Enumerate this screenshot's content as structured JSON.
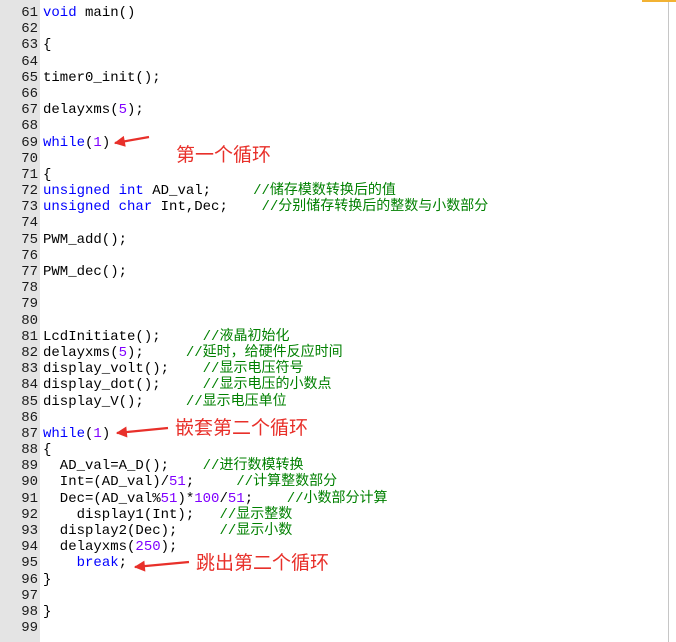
{
  "editor": {
    "lines": [
      {
        "n": "61",
        "tokens": [
          {
            "keyword": "void"
          },
          {
            "text": " main()"
          }
        ]
      },
      {
        "n": "62",
        "tokens": []
      },
      {
        "n": "63",
        "tokens": [
          {
            "text": "{"
          }
        ]
      },
      {
        "n": "64",
        "tokens": []
      },
      {
        "n": "65",
        "tokens": [
          {
            "text": "timer0_init();"
          }
        ]
      },
      {
        "n": "66",
        "tokens": []
      },
      {
        "n": "67",
        "tokens": [
          {
            "text": "delayxms("
          },
          {
            "number": "5"
          },
          {
            "text": ");"
          }
        ]
      },
      {
        "n": "68",
        "tokens": []
      },
      {
        "n": "69",
        "tokens": [
          {
            "keyword": "while"
          },
          {
            "text": "("
          },
          {
            "number": "1"
          },
          {
            "text": ")"
          }
        ]
      },
      {
        "n": "70",
        "tokens": []
      },
      {
        "n": "71",
        "tokens": [
          {
            "text": "{"
          }
        ]
      },
      {
        "n": "72",
        "tokens": [
          {
            "keyword": "unsigned"
          },
          {
            "text": " "
          },
          {
            "keyword": "int"
          },
          {
            "text": " AD_val;     "
          },
          {
            "comment": "//储存模数转换后的值"
          }
        ]
      },
      {
        "n": "73",
        "tokens": [
          {
            "keyword": "unsigned"
          },
          {
            "text": " "
          },
          {
            "keyword": "char"
          },
          {
            "text": " Int,Dec;    "
          },
          {
            "comment": "//分别储存转换后的整数与小数部分"
          }
        ]
      },
      {
        "n": "74",
        "tokens": []
      },
      {
        "n": "75",
        "tokens": [
          {
            "text": "PWM_add();"
          }
        ]
      },
      {
        "n": "76",
        "tokens": []
      },
      {
        "n": "77",
        "tokens": [
          {
            "text": "PWM_dec();"
          }
        ]
      },
      {
        "n": "78",
        "tokens": []
      },
      {
        "n": "79",
        "tokens": []
      },
      {
        "n": "80",
        "tokens": []
      },
      {
        "n": "81",
        "tokens": [
          {
            "text": "LcdInitiate();     "
          },
          {
            "comment": "//液晶初始化"
          }
        ]
      },
      {
        "n": "82",
        "tokens": [
          {
            "text": "delayxms("
          },
          {
            "number": "5"
          },
          {
            "text": ");     "
          },
          {
            "comment": "//延时，给硬件反应时间"
          }
        ]
      },
      {
        "n": "83",
        "tokens": [
          {
            "text": "display_volt();    "
          },
          {
            "comment": "//显示电压符号"
          }
        ]
      },
      {
        "n": "84",
        "tokens": [
          {
            "text": "display_dot();     "
          },
          {
            "comment": "//显示电压的小数点"
          }
        ]
      },
      {
        "n": "85",
        "tokens": [
          {
            "text": "display_V();     "
          },
          {
            "comment": "//显示电压单位"
          }
        ]
      },
      {
        "n": "86",
        "tokens": []
      },
      {
        "n": "87",
        "tokens": [
          {
            "keyword": "while"
          },
          {
            "text": "("
          },
          {
            "number": "1"
          },
          {
            "text": ")"
          }
        ]
      },
      {
        "n": "88",
        "tokens": [
          {
            "text": "{"
          }
        ]
      },
      {
        "n": "89",
        "tokens": [
          {
            "text": "  AD_val=A_D();    "
          },
          {
            "comment": "//进行数模转换"
          }
        ]
      },
      {
        "n": "90",
        "tokens": [
          {
            "text": "  Int=(AD_val)/"
          },
          {
            "number": "51"
          },
          {
            "text": ";     "
          },
          {
            "comment": "//计算整数部分"
          }
        ]
      },
      {
        "n": "91",
        "tokens": [
          {
            "text": "  Dec=(AD_val%"
          },
          {
            "number": "51"
          },
          {
            "text": ")*"
          },
          {
            "number": "100"
          },
          {
            "text": "/"
          },
          {
            "number": "51"
          },
          {
            "text": ";    "
          },
          {
            "comment": "//小数部分计算"
          }
        ]
      },
      {
        "n": "92",
        "tokens": [
          {
            "text": "    display1(Int);   "
          },
          {
            "comment": "//显示整数"
          }
        ]
      },
      {
        "n": "93",
        "tokens": [
          {
            "text": "  display2(Dec);     "
          },
          {
            "comment": "//显示小数"
          }
        ]
      },
      {
        "n": "94",
        "tokens": [
          {
            "text": "  delayxms("
          },
          {
            "number": "250"
          },
          {
            "text": ");"
          }
        ]
      },
      {
        "n": "95",
        "tokens": [
          {
            "text": "    "
          },
          {
            "keyword": "break"
          },
          {
            "text": ";"
          }
        ]
      },
      {
        "n": "96",
        "tokens": [
          {
            "text": "}"
          }
        ]
      },
      {
        "n": "97",
        "tokens": []
      },
      {
        "n": "98",
        "tokens": [
          {
            "text": "}"
          }
        ]
      },
      {
        "n": "99",
        "tokens": []
      }
    ]
  },
  "annotations": [
    "第一个循环",
    "嵌套第二个循环",
    "跳出第二个循环"
  ],
  "colors": {
    "keyword": "#0000ff",
    "number": "#8000ff",
    "comment": "#008000",
    "text": "#000000",
    "annotation": "#e8302a",
    "gutter": "#e4e4e4"
  }
}
